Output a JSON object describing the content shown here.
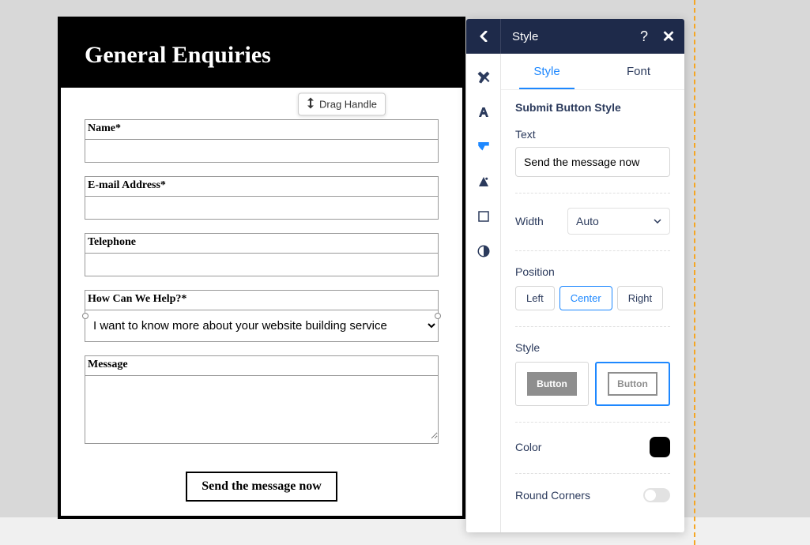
{
  "form": {
    "title": "General Enquiries",
    "drag_label": "Drag Handle",
    "fields": {
      "name": {
        "label": "Name*",
        "value": ""
      },
      "email": {
        "label": "E-mail Address*",
        "value": ""
      },
      "phone": {
        "label": "Telephone",
        "value": ""
      },
      "help": {
        "label": "How Can We Help?*",
        "selected": "I want to know more about your website building service"
      },
      "message": {
        "label": "Message",
        "value": ""
      }
    },
    "submit_label": "Send the message now"
  },
  "panel": {
    "title": "Style",
    "help_glyph": "?",
    "close_glyph": "✕",
    "sidebar": {
      "items": [
        {
          "name": "tools",
          "icon": "tools-icon"
        },
        {
          "name": "font",
          "icon": "font-icon"
        },
        {
          "name": "style",
          "icon": "style-icon"
        },
        {
          "name": "effects",
          "icon": "effects-icon"
        },
        {
          "name": "box",
          "icon": "box-icon"
        },
        {
          "name": "contrast",
          "icon": "contrast-icon"
        }
      ]
    },
    "subtabs": {
      "style": "Style",
      "font": "Font"
    },
    "content": {
      "section_title": "Submit Button Style",
      "text_label": "Text",
      "text_value": "Send the message now",
      "width_label": "Width",
      "width_value": "Auto",
      "position_label": "Position",
      "positions": {
        "left": "Left",
        "center": "Center",
        "right": "Right"
      },
      "style_label": "Style",
      "style_button_text": "Button",
      "color_label": "Color",
      "color_value": "#000000",
      "round_label": "Round Corners",
      "round_on": false
    }
  }
}
